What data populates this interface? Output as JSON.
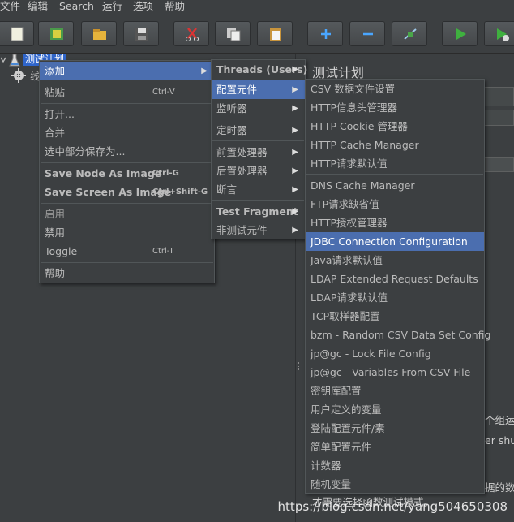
{
  "menubar": [
    "文件",
    "编辑",
    "Search",
    "运行",
    "选项",
    "帮助"
  ],
  "tree": {
    "root_label": "测试计划",
    "child_label": "线"
  },
  "context_menu": [
    {
      "label": "添加",
      "submenu": true,
      "highlighted": true
    },
    {
      "label": "粘贴",
      "shortcut": "Ctrl-V"
    },
    {
      "label": "打开..."
    },
    {
      "label": "合并"
    },
    {
      "label": "选中部分保存为..."
    },
    {
      "label": "Save Node As Image",
      "shortcut": "Ctrl-G"
    },
    {
      "label": "Save Screen As Image",
      "shortcut": "Ctrl+Shift-G"
    },
    {
      "label": "启用",
      "disabled": true
    },
    {
      "label": "禁用"
    },
    {
      "label": "Toggle",
      "shortcut": "Ctrl-T"
    },
    {
      "label": "帮助"
    }
  ],
  "add_submenu": [
    {
      "label": "Threads (Users)",
      "submenu": true
    },
    {
      "label": "配置元件",
      "submenu": true,
      "highlighted": true
    },
    {
      "label": "监听器",
      "submenu": true
    },
    {
      "label": "定时器",
      "submenu": true
    },
    {
      "label": "前置处理器",
      "submenu": true
    },
    {
      "label": "后置处理器",
      "submenu": true
    },
    {
      "label": "断言",
      "submenu": true
    },
    {
      "label": "Test Fragment",
      "submenu": true
    },
    {
      "label": "非测试元件",
      "submenu": true
    }
  ],
  "config_submenu": [
    "CSV 数据文件设置",
    "HTTP信息头管理器",
    "HTTP Cookie 管理器",
    "HTTP Cache Manager",
    "HTTP请求默认值",
    "DNS Cache Manager",
    "FTP请求缺省值",
    "HTTP授权管理器",
    "JDBC Connection Configuration",
    "Java请求默认值",
    "LDAP Extended Request Defaults",
    "LDAP请求默认值",
    "TCP取样器配置",
    "bzm - Random CSV Data Set Config",
    "jp@gc - Lock File Config",
    "jp@gc - Variables From CSV File",
    "密钥库配置",
    "用户定义的变量",
    "登陆配置元件/素",
    "简单配置元件",
    "计数器",
    "随机变量"
  ],
  "config_highlighted": "JDBC Connection Configuration",
  "right_panel": {
    "title": "测试计划",
    "frag1": "个组运行",
    "frag2": "er shut",
    "frag3": "据的数据",
    "frag4": "才需要选择函数测试模式。"
  },
  "watermark": "https://blog.csdn.net/yang504650308"
}
